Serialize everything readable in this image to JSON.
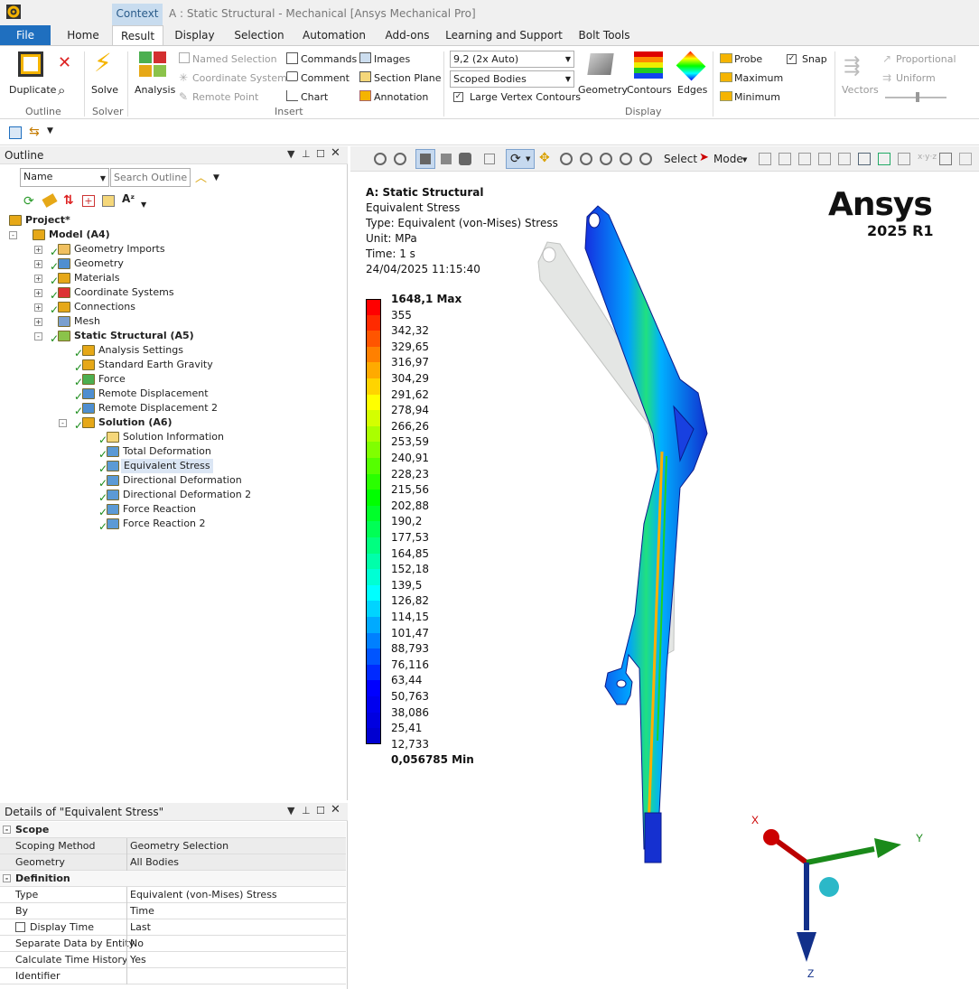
{
  "titlebar": {
    "context_tab": "Context",
    "window_title": "A : Static Structural - Mechanical [Ansys Mechanical Pro]"
  },
  "menu": {
    "tabs": [
      {
        "label": "File"
      },
      {
        "label": "Home"
      },
      {
        "label": "Result"
      },
      {
        "label": "Display"
      },
      {
        "label": "Selection"
      },
      {
        "label": "Automation"
      },
      {
        "label": "Add-ons"
      },
      {
        "label": "Learning and Support"
      },
      {
        "label": "Bolt Tools"
      }
    ]
  },
  "ribbon": {
    "outline_group": {
      "duplicate": "Duplicate",
      "group_label": "Outline"
    },
    "solver_group": {
      "solve": "Solve",
      "group_label": "Solver"
    },
    "insert_group": {
      "analysis": "Analysis",
      "named_selection": "Named Selection",
      "coordinate_system": "Coordinate System",
      "remote_point": "Remote Point",
      "commands": "Commands",
      "comment": "Comment",
      "chart": "Chart",
      "images": "Images",
      "section_plane": "Section Plane",
      "annotation": "Annotation",
      "group_label": "Insert"
    },
    "display_group": {
      "scale_value": "9,2 (2x Auto)",
      "scope_value": "Scoped Bodies",
      "large_vertex": "Large Vertex Contours",
      "geometry": "Geometry",
      "contours": "Contours",
      "edges": "Edges",
      "group_label": "Display"
    },
    "probe_group": {
      "probe": "Probe",
      "maximum": "Maximum",
      "minimum": "Minimum",
      "snap": "Snap"
    },
    "vectors_group": {
      "vectors": "Vectors",
      "proportional": "Proportional",
      "uniform": "Uniform"
    }
  },
  "outline": {
    "title": "Outline",
    "filter_value": "Name",
    "search_placeholder": "Search Outline",
    "tree": [
      {
        "label": "Project*"
      },
      {
        "label": "Model (A4)"
      },
      {
        "label": "Geometry Imports"
      },
      {
        "label": "Geometry"
      },
      {
        "label": "Materials"
      },
      {
        "label": "Coordinate Systems"
      },
      {
        "label": "Connections"
      },
      {
        "label": "Mesh"
      },
      {
        "label": "Static Structural (A5)"
      },
      {
        "label": "Analysis Settings"
      },
      {
        "label": "Standard Earth Gravity"
      },
      {
        "label": "Force"
      },
      {
        "label": "Remote Displacement"
      },
      {
        "label": "Remote Displacement 2"
      },
      {
        "label": "Solution (A6)"
      },
      {
        "label": "Solution Information"
      },
      {
        "label": "Total Deformation"
      },
      {
        "label": "Equivalent Stress"
      },
      {
        "label": "Directional Deformation"
      },
      {
        "label": "Directional Deformation 2"
      },
      {
        "label": "Force Reaction"
      },
      {
        "label": "Force Reaction 2"
      }
    ]
  },
  "details": {
    "title": "Details of \"Equivalent Stress\"",
    "rows": [
      {
        "key": "Scope",
        "value": ""
      },
      {
        "key": "Scoping Method",
        "value": "Geometry Selection"
      },
      {
        "key": "Geometry",
        "value": "All Bodies"
      },
      {
        "key": "Definition",
        "value": ""
      },
      {
        "key": "Type",
        "value": "Equivalent (von-Mises) Stress"
      },
      {
        "key": "By",
        "value": "Time"
      },
      {
        "key": "Display Time",
        "value": "Last"
      },
      {
        "key": "Separate Data by Entity",
        "value": "No"
      },
      {
        "key": "Calculate Time History",
        "value": "Yes"
      },
      {
        "key": "Identifier",
        "value": ""
      }
    ]
  },
  "viewtoolbar": {
    "select": "Select",
    "mode": "Mode"
  },
  "viewport": {
    "info": {
      "title": "A: Static Structural",
      "result": "Equivalent Stress",
      "type": "Type: Equivalent (von-Mises) Stress",
      "unit": "Unit: MPa",
      "time": "Time: 1 s",
      "date": "24/04/2025 11:15:40"
    },
    "brand": {
      "name": "Ansys",
      "version": "2025 R1"
    },
    "legend": {
      "labels": [
        "1648,1 Max",
        "355",
        "342,32",
        "329,65",
        "316,97",
        "304,29",
        "291,62",
        "278,94",
        "266,26",
        "253,59",
        "240,91",
        "228,23",
        "215,56",
        "202,88",
        "190,2",
        "177,53",
        "164,85",
        "152,18",
        "139,5",
        "126,82",
        "114,15",
        "101,47",
        "88,793",
        "76,116",
        "63,44",
        "50,763",
        "38,086",
        "25,41",
        "12,733",
        "0,056785 Min"
      ],
      "colors": [
        "#ff0000",
        "#ff2a00",
        "#ff5500",
        "#ff8000",
        "#ffaa00",
        "#ffd400",
        "#ffff00",
        "#d4ff00",
        "#aaff00",
        "#80ff00",
        "#55ff00",
        "#2aff00",
        "#00ff00",
        "#00ff2a",
        "#00ff55",
        "#00ff80",
        "#00ffaa",
        "#00ffd4",
        "#00ffff",
        "#00d4ff",
        "#00aaff",
        "#0080ff",
        "#0055ff",
        "#002aff",
        "#0000ff",
        "#0000ee",
        "#0000e0",
        "#0000d0"
      ]
    },
    "triad": {
      "x": "X",
      "y": "Y",
      "z": "Z"
    }
  }
}
